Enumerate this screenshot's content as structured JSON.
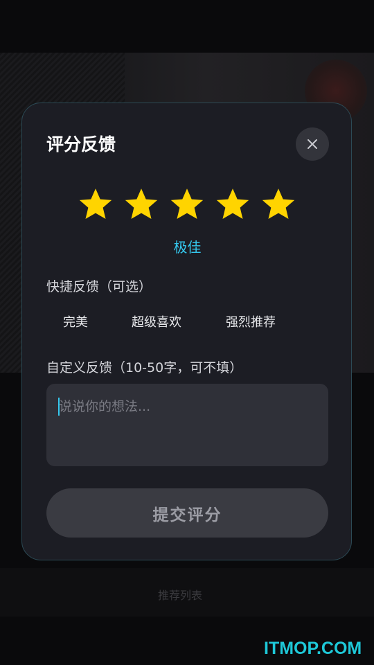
{
  "dialog": {
    "title": "评分反馈",
    "rating": {
      "value": 5,
      "max": 5,
      "label": "极佳",
      "star_color": "#FFD400"
    },
    "quick_feedback": {
      "label": "快捷反馈（可选）",
      "options": [
        "完美",
        "超级喜欢",
        "强烈推荐"
      ]
    },
    "custom_feedback": {
      "label": "自定义反馈（10-50字，可不填）",
      "placeholder": "说说你的想法...",
      "value": ""
    },
    "submit_label": "提交评分",
    "close_icon": "close-icon"
  },
  "background": {
    "caption": "推荐列表"
  },
  "watermark": "ITMOP.COM",
  "colors": {
    "accent": "#35C8EE",
    "dialog_bg": "#1C1D24",
    "watermark": "#1EC8D8"
  }
}
